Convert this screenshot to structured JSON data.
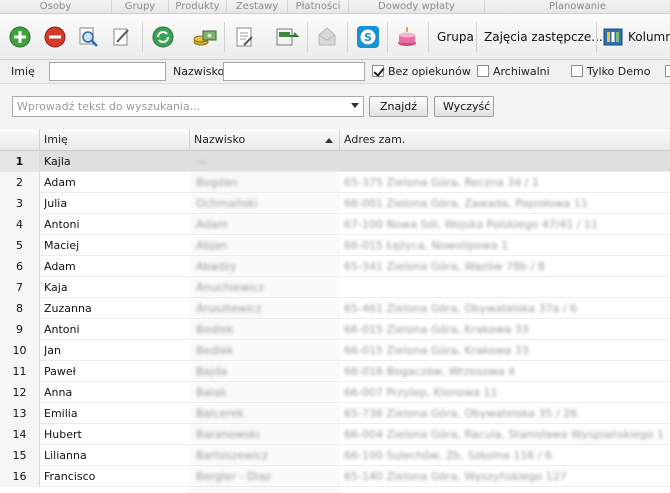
{
  "ribbon_groups": [
    "Osoby",
    "Grupy",
    "Produkty",
    "Zestawy",
    "Płatności",
    "Dowody wpłaty",
    "Planowanie"
  ],
  "toolbar": {
    "icons": [
      "add-icon",
      "delete-icon",
      "preview-icon",
      "edit-icon",
      "refresh-icon",
      "money-icon",
      "document-icon",
      "mail-icon",
      "envelope-icon",
      "skype-icon",
      "cake-icon",
      "columns-icon"
    ],
    "grupa_label": "Grupa",
    "zajecia_label": "Zajęcia zastępcze...",
    "kolumny_label": "Kolumn"
  },
  "filters": {
    "imie_label": "Imię",
    "imie_value": "",
    "nazwisko_label": "Nazwisko",
    "nazwisko_value": "",
    "bez_opiekunow_label": "Bez opiekunów",
    "bez_opiekunow_checked": true,
    "archiwalni_label": "Archiwalni",
    "archiwalni_checked": false,
    "tylko_demo_label": "Tylko Demo",
    "tylko_demo_checked": false
  },
  "search": {
    "placeholder": "Wprowadź tekst do wyszukania...",
    "find_button": "Znajdź",
    "clear_button": "Wyczyść"
  },
  "grid": {
    "columns": [
      "Imię",
      "Nazwisko",
      "Adres zam."
    ],
    "sorted_column": "Nazwisko",
    "rows": [
      {
        "num": "1",
        "first": "Kajla",
        "last": "—",
        "addr": ""
      },
      {
        "num": "2",
        "first": "Adam",
        "last": "Bogdan",
        "addr": "65-375 Zielona Góra, Reczna 34 / 1"
      },
      {
        "num": "3",
        "first": "Julia",
        "last": "Ochmański",
        "addr": "66-001 Zielona Góra, Zawada, Popiołowa 11"
      },
      {
        "num": "4",
        "first": "Antoni",
        "last": "Adam",
        "addr": "67-100 Nowa Sól, Wojska Polskiego 47/41 / 11"
      },
      {
        "num": "5",
        "first": "Maciej",
        "last": "Abjan",
        "addr": "66-015 Łężyca, Nowolipowa 1"
      },
      {
        "num": "6",
        "first": "Adam",
        "last": "Abadzy",
        "addr": "65-341 Zielona Góra, Wazów 78b / 8"
      },
      {
        "num": "7",
        "first": "Kaja",
        "last": "Anuchiewicz",
        "addr": ""
      },
      {
        "num": "8",
        "first": "Zuzanna",
        "last": "Arusztewicz",
        "addr": "65-461 Zielona Góra, Obywatelska 37a / 6"
      },
      {
        "num": "9",
        "first": "Antoni",
        "last": "Bedlek",
        "addr": "66-015 Zielona Góra, Krakowa 33"
      },
      {
        "num": "10",
        "first": "Jan",
        "last": "Bedlek",
        "addr": "66-015 Zielona Góra, Krakowa 33"
      },
      {
        "num": "11",
        "first": "Paweł",
        "last": "Bajda",
        "addr": "66-016 Bogaczów, Wrzosowa 4"
      },
      {
        "num": "12",
        "first": "Anna",
        "last": "Balak",
        "addr": "66-007 Przylep, Klonowa 11"
      },
      {
        "num": "13",
        "first": "Emilia",
        "last": "Balcerek",
        "addr": "65-736 Zielona Góra, Obywatelska 35 / 26"
      },
      {
        "num": "14",
        "first": "Hubert",
        "last": "Baranowski",
        "addr": "66-004 Zielona Góra, Racula, Stanisława Wyspiańskiego 17"
      },
      {
        "num": "15",
        "first": "Lilianna",
        "last": "Bartoszewicz",
        "addr": "66-100 Sulechów, Zb. Szkolna 116 / 6"
      },
      {
        "num": "16",
        "first": "Francisco",
        "last": "Bergler - Diaz",
        "addr": "65-140 Zielona Góra, Wyszyńskiego 127"
      }
    ]
  }
}
